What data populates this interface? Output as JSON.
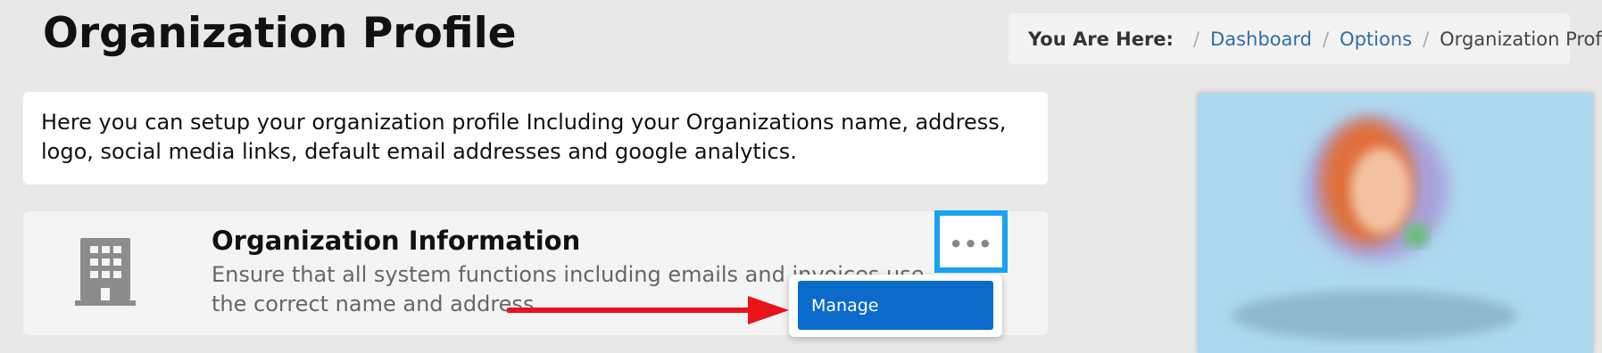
{
  "page": {
    "title": "Organization Profile"
  },
  "breadcrumb": {
    "label": "You Are Here:",
    "items": [
      {
        "text": "Dashboard"
      },
      {
        "text": "Options"
      },
      {
        "text": "Organization Profile"
      }
    ]
  },
  "intro": {
    "text": "Here you can setup your organization profile Including your Organizations name, address, logo, social media links, default email addresses and google analytics."
  },
  "org_card": {
    "icon": "building-icon",
    "title": "Organization Information",
    "description": "Ensure that all system functions including emails and invoices use the correct name and address.",
    "menu_label": "•••",
    "menu_items": [
      {
        "label": "Manage"
      }
    ]
  },
  "colors": {
    "accent": "#0a6bcb",
    "highlight_border": "#1aa3f0",
    "arrow": "#e8141a",
    "link": "#2f6ea8"
  }
}
